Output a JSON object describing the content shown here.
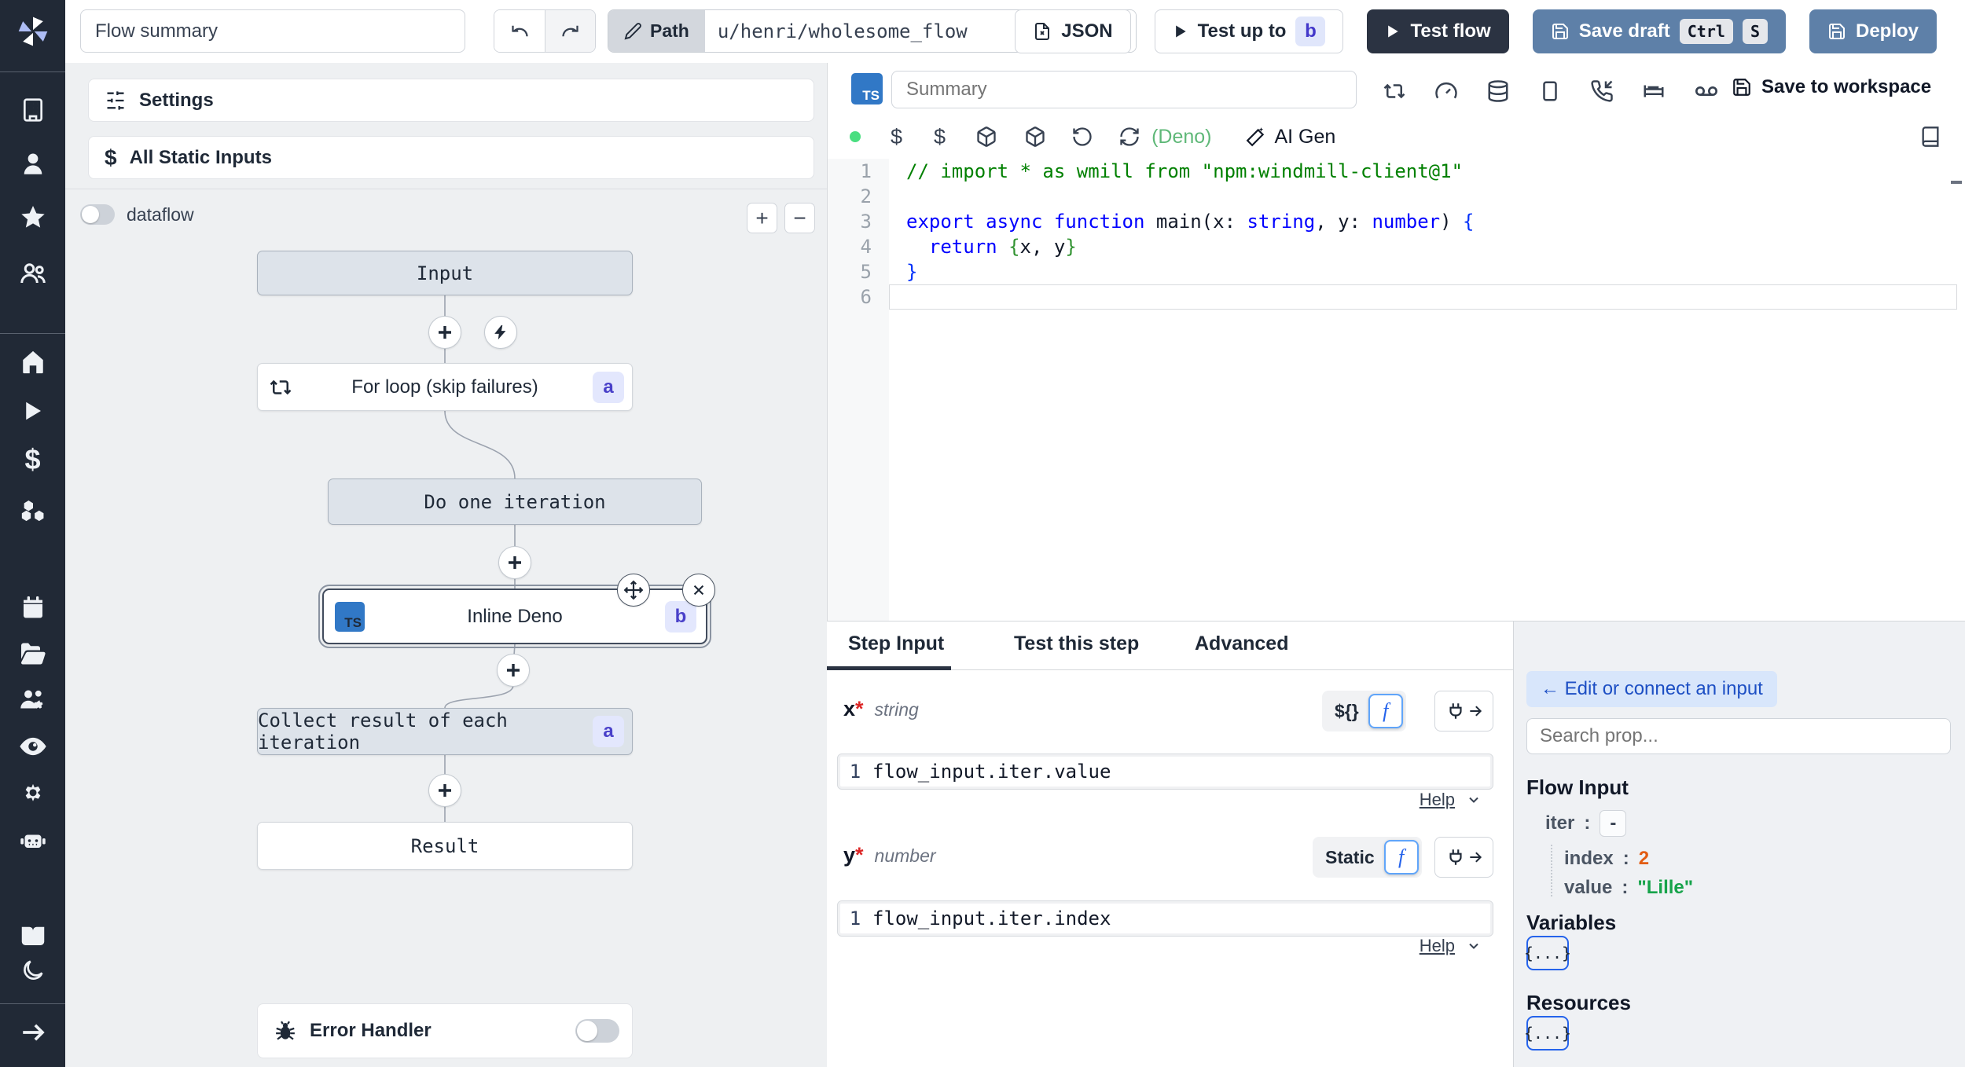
{
  "topbar": {
    "flow_summary_value": "Flow summary",
    "path_label": "Path",
    "path_value": "u/henri/wholesome_flow",
    "json_button": "JSON",
    "test_up_to_label": "Test up to",
    "test_up_to_badge": "b",
    "test_flow_label": "Test flow",
    "save_draft_label": "Save draft",
    "save_draft_kbd": [
      "Ctrl",
      "S"
    ],
    "deploy_label": "Deploy"
  },
  "left_panel": {
    "settings_label": "Settings",
    "static_inputs_label": "All Static Inputs",
    "static_inputs_icon": "$",
    "dataflow_label": "dataflow",
    "zoom_in": "+",
    "zoom_out": "−",
    "error_handler_label": "Error Handler"
  },
  "graph": {
    "nodes": [
      {
        "id": "input",
        "label": "Input"
      },
      {
        "id": "forloop",
        "label": "For loop (skip failures)",
        "badge": "a"
      },
      {
        "id": "iteration",
        "label": "Do one iteration"
      },
      {
        "id": "inline_deno",
        "label": "Inline Deno",
        "badge": "b",
        "lang_badge": "TS"
      },
      {
        "id": "collect",
        "label": "Collect result of each iteration",
        "badge": "a"
      },
      {
        "id": "result",
        "label": "Result"
      }
    ]
  },
  "editor": {
    "lang_badge": "TS",
    "summary_placeholder": "Summary",
    "runtime_label": "(Deno)",
    "ai_gen_label": "AI Gen",
    "save_workspace_label": "Save to workspace",
    "dollar_icon": "$",
    "active_line": "6",
    "code_lines": [
      {
        "no": "1",
        "tokens": [
          {
            "t": "// import * as wmill from \"npm:windmill-client@1\"",
            "c": "comment"
          }
        ]
      },
      {
        "no": "2",
        "tokens": []
      },
      {
        "no": "3",
        "tokens": [
          {
            "t": "export async function",
            "c": "kw"
          },
          {
            "t": " main(x: ",
            "c": "plain"
          },
          {
            "t": "string",
            "c": "kw"
          },
          {
            "t": ", y: ",
            "c": "plain"
          },
          {
            "t": "number",
            "c": "kw"
          },
          {
            "t": ") ",
            "c": "plain"
          },
          {
            "t": "{",
            "c": "brace1"
          }
        ]
      },
      {
        "no": "4",
        "tokens": [
          {
            "t": "  ",
            "c": "plain"
          },
          {
            "t": "return",
            "c": "kw"
          },
          {
            "t": " ",
            "c": "plain"
          },
          {
            "t": "{",
            "c": "brace2"
          },
          {
            "t": "x, y",
            "c": "plain"
          },
          {
            "t": "}",
            "c": "brace2"
          }
        ]
      },
      {
        "no": "5",
        "tokens": [
          {
            "t": "}",
            "c": "brace1"
          }
        ]
      },
      {
        "no": "6",
        "tokens": []
      }
    ]
  },
  "step_panel": {
    "tabs": [
      "Step Input",
      "Test this step",
      "Advanced"
    ],
    "active_tab": "Step Input",
    "fields": [
      {
        "name": "x",
        "required": "*",
        "type": "string",
        "mode": "${}",
        "line_no": "1",
        "value": "flow_input.iter.value",
        "help": "Help"
      },
      {
        "name": "y",
        "required": "*",
        "type": "number",
        "mode": "Static",
        "line_no": "1",
        "value": "flow_input.iter.index",
        "help": "Help"
      }
    ]
  },
  "connect_panel": {
    "back_button": "← Edit or connect an input",
    "search_placeholder": "Search prop...",
    "flow_input_title": "Flow Input",
    "tree": [
      {
        "key": "iter",
        "colon": ":",
        "value": "-"
      },
      {
        "key": "index",
        "colon": ":",
        "value": "2"
      },
      {
        "key": "value",
        "colon": ":",
        "value": "\"Lille\""
      }
    ],
    "variables_title": "Variables",
    "variables_chip": "{...}",
    "resources_title": "Resources",
    "resources_chip": "{...}"
  },
  "colors": {
    "sidebar_bg": "#212936",
    "accent_dark_button": "#2b3342",
    "accent_blue_button": "#5e80a8",
    "badge_bg": "#e3e7fd",
    "badge_text": "#4940c9",
    "ts_badge": "#3178c6",
    "run_dot_green": "#4ade80",
    "deno_green": "#5fb878",
    "tree_num_orange": "#e25c12",
    "tree_str_green": "#16a34a",
    "connect_pill_bg": "#d8e6fb",
    "connect_pill_text": "#1d4fc4"
  }
}
